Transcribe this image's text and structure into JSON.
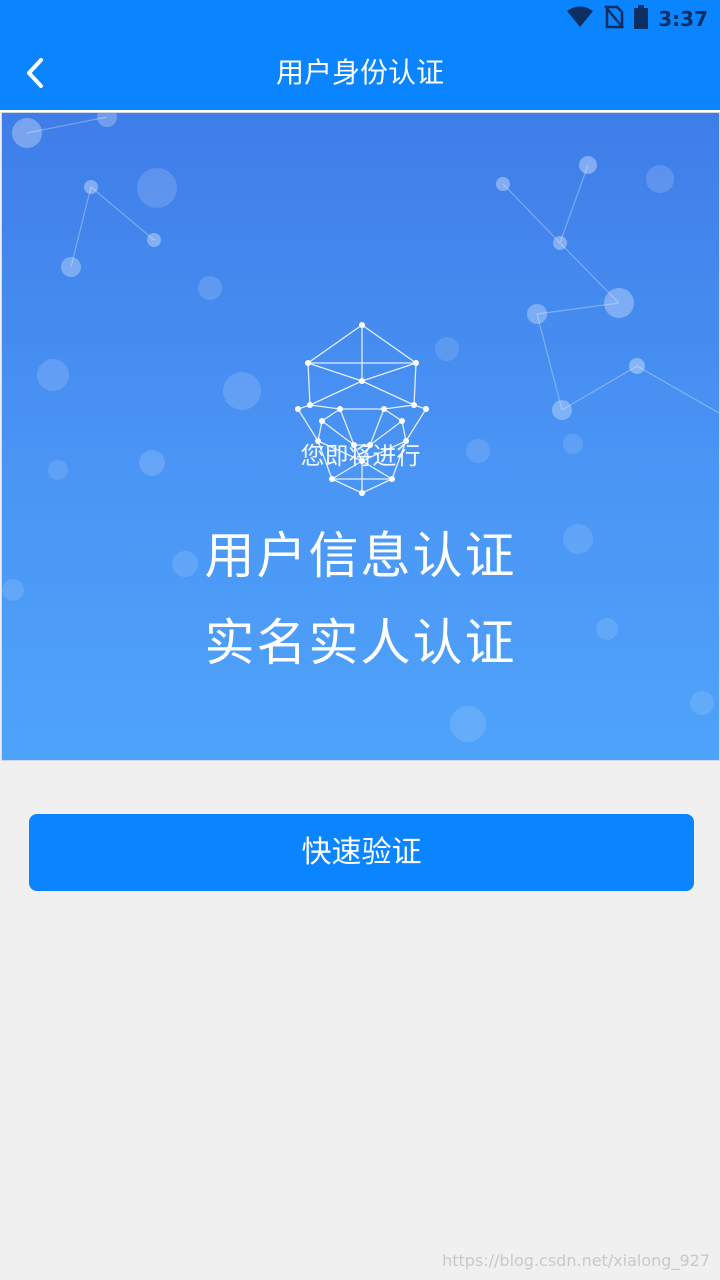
{
  "status_bar": {
    "time": "3:37",
    "icons": [
      "wifi-icon",
      "no-sim-icon",
      "battery-icon"
    ]
  },
  "header": {
    "back_icon": "chevron-left-icon",
    "title": "用户身份认证"
  },
  "banner": {
    "intro": "您即将进行",
    "line1": "用户信息认证",
    "line2": "实名实人认证",
    "icon": "face-scan-icon"
  },
  "actions": {
    "verify_label": "快速验证"
  },
  "watermark": "https://blog.csdn.net/xialong_927",
  "colors": {
    "primary": "#0a84ff",
    "page_bg": "#f0f0f0",
    "banner_top": "#3f7de8",
    "banner_bottom": "#4fa3fa"
  }
}
